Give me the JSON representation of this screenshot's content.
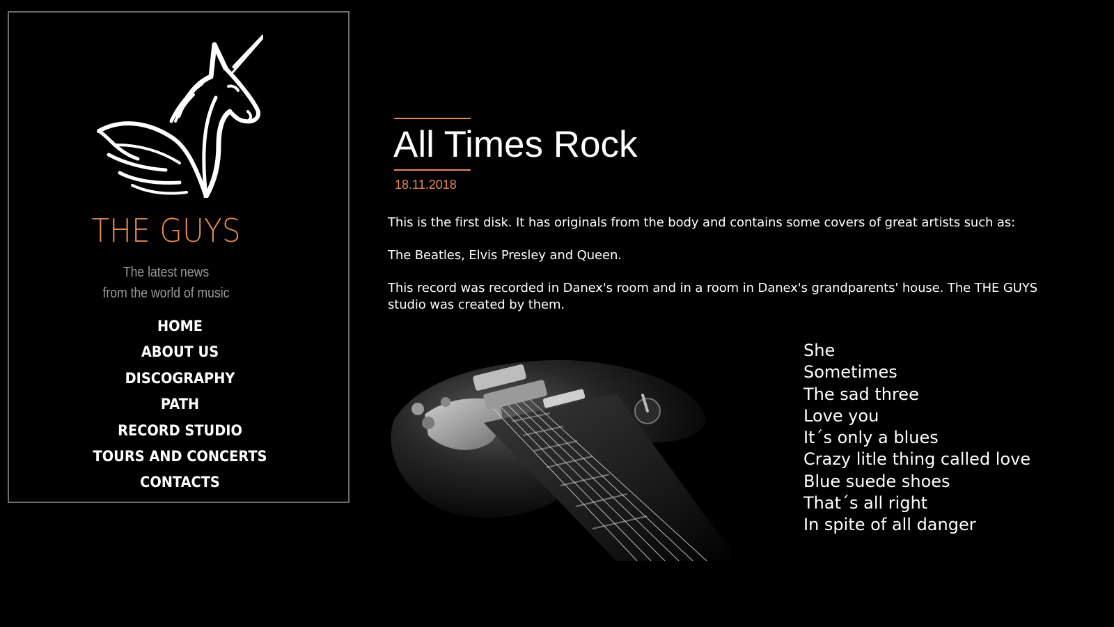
{
  "sidebar": {
    "logo_icon": "unicorn-icon",
    "brand": "THE GUYS",
    "tagline_line1": "The latest news",
    "tagline_line2": "from the world of music",
    "nav": [
      {
        "label": "HOME"
      },
      {
        "label": "ABOUT US"
      },
      {
        "label": "DISCOGRAPHY"
      },
      {
        "label": "PATH"
      },
      {
        "label": "RECORD STUDIO"
      },
      {
        "label": "TOURS AND CONCERTS"
      },
      {
        "label": "CONTACTS"
      }
    ]
  },
  "post": {
    "title": "All Times Rock",
    "date": "18.11.2018",
    "paragraphs": [
      "This is the first disk. It has originals from the body and contains some covers of great artists such as:",
      "The Beatles, Elvis Presley and Queen.",
      "This record was recorded in Danex's room and in a room in Danex's grandparents' house. The THE GUYS studio was created by them."
    ],
    "image": "electric-guitar-photo",
    "tracks": [
      "She",
      "Sometimes",
      "The sad three",
      "Love you",
      "It´s only a blues",
      "Crazy litle thing called love",
      "Blue suede shoes",
      "That´s all right",
      "In spite of all danger"
    ]
  },
  "colors": {
    "background": "#000000",
    "accent": "#e58a4f",
    "text": "#ffffff",
    "muted": "#9a9a9a",
    "border": "#6e6e6e"
  }
}
